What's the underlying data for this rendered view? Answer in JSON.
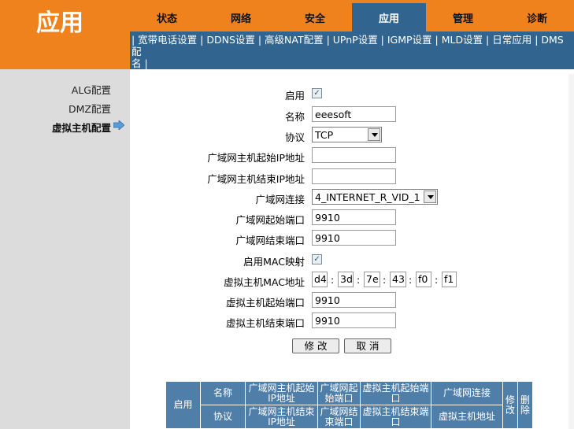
{
  "brand": "应用",
  "tabs": [
    "状态",
    "网络",
    "安全",
    "应用",
    "管理",
    "诊断"
  ],
  "subnav": {
    "text_line1": "| 宽带电话设置 | DDNS设置 | 高级NAT配置 | UPnP设置 | IGMP设置 | MLD设置 | 日常应用 | DMS配",
    "text_line2": "名 |"
  },
  "subnav_items": [
    "宽带电话设置",
    "DDNS设置",
    "高级NAT配置",
    "UPnP设置",
    "IGMP设置",
    "MLD设置",
    "日常应用",
    "DMS配名"
  ],
  "leftnav": [
    "ALG配置",
    "DMZ配置",
    "虚拟主机配置"
  ],
  "form": {
    "enable_label": "启用",
    "name_label": "名称",
    "name_value": "eeesoft",
    "protocol_label": "协议",
    "protocol_value": "TCP",
    "wan_start_ip_label": "广域网主机起始IP地址",
    "wan_start_ip_value": "",
    "wan_end_ip_label": "广域网主机结束IP地址",
    "wan_end_ip_value": "",
    "wan_conn_label": "广域网连接",
    "wan_conn_value": "4_INTERNET_R_VID_1",
    "wan_start_port_label": "广域网起始端口",
    "wan_start_port_value": "9910",
    "wan_end_port_label": "广域网结束端口",
    "wan_end_port_value": "9910",
    "mac_map_label": "启用MAC映射",
    "vhost_mac_label": "虚拟主机MAC地址",
    "mac": [
      "d4",
      "3d",
      "7e",
      "43",
      "f0",
      "f1"
    ],
    "vhost_start_port_label": "虚拟主机起始端口",
    "vhost_start_port_value": "9910",
    "vhost_end_port_label": "虚拟主机结束端口",
    "vhost_end_port_value": "9910",
    "modify_button": "修 改",
    "cancel_button": "取 消"
  },
  "table": {
    "enable": "启用",
    "name": "名称",
    "protocol": "协议",
    "wan_start_ip_1": "广域网主机起始",
    "wan_start_ip_2": "IP地址",
    "wan_end_ip_1": "广域网主机结束",
    "wan_end_ip_2": "IP地址",
    "wan_start_port_1": "广域网起",
    "wan_start_port_2": "始端口",
    "wan_end_port_1": "广域网结",
    "wan_end_port_2": "束端口",
    "vhost_start_port_1": "虚拟主机起始端",
    "vhost_start_port_2": "口",
    "vhost_end_port_1": "虚拟主机结束端",
    "vhost_end_port_2": "口",
    "wan_conn": "广域网连接",
    "vhost_ip": "虚拟主机地址",
    "modify_1": "修",
    "modify_2": "改",
    "delete_1": "删",
    "delete_2": "除"
  },
  "colors": {
    "orange": "#f0821e",
    "blue": "#31658f",
    "table_blue": "#4f7ea8"
  },
  "icons": {
    "nav_arrow": "arrow-right-icon",
    "checkbox": "check-icon"
  }
}
